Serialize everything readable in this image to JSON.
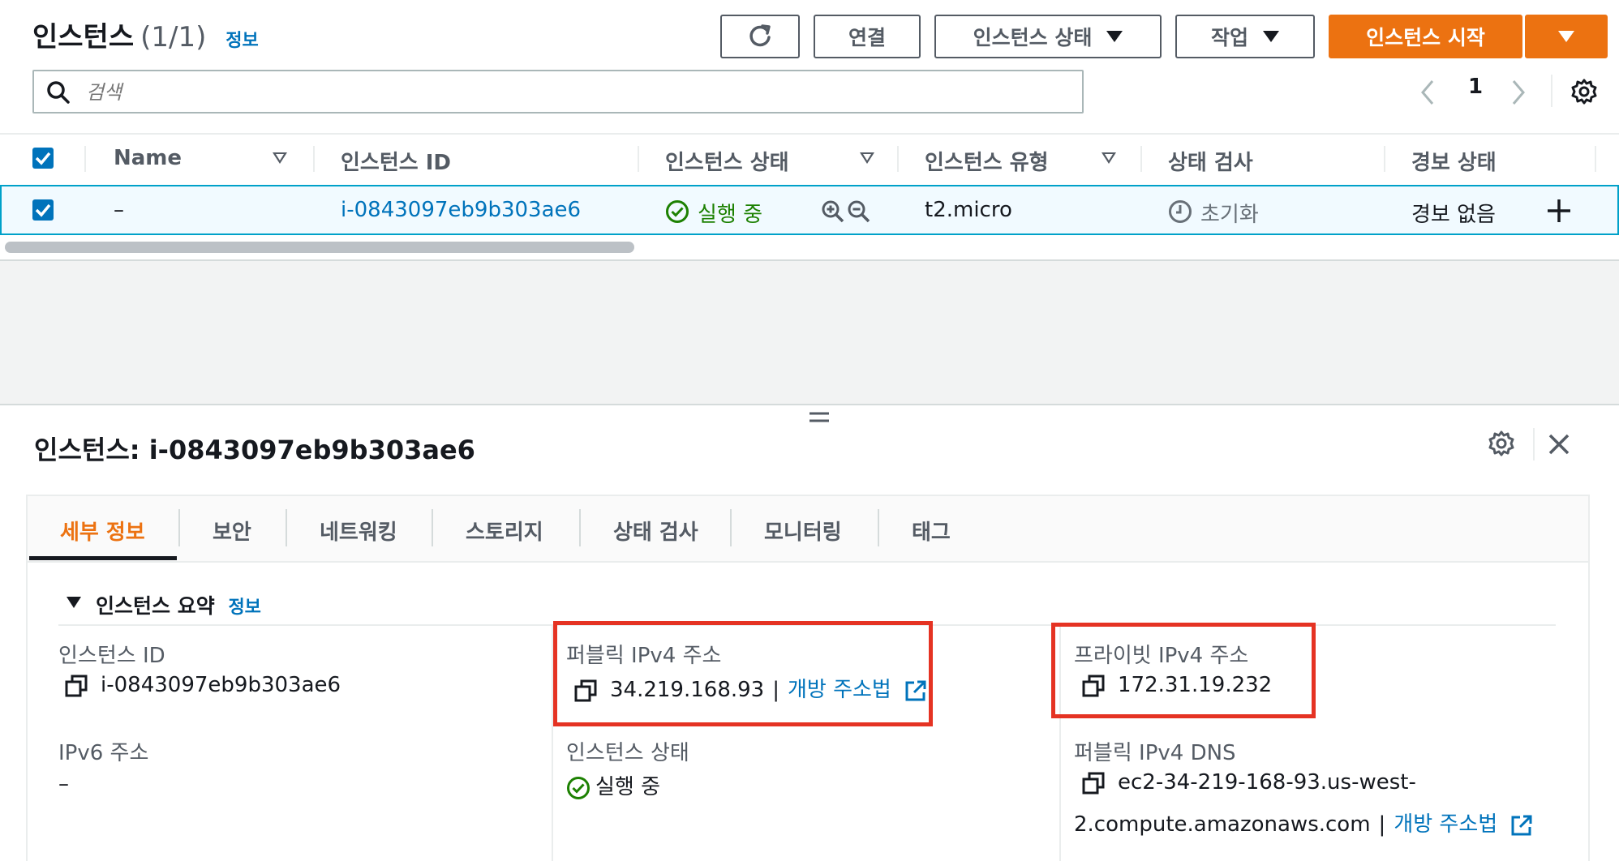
{
  "header": {
    "title": "인스턴스",
    "count": "(1/1)",
    "info_label": "정보",
    "buttons": {
      "connect": "연결",
      "instance_state": "인스턴스 상태",
      "actions": "작업",
      "launch": "인스턴스 시작"
    }
  },
  "search": {
    "placeholder": "검색"
  },
  "pagination": {
    "current_page": "1"
  },
  "table": {
    "columns": [
      "Name",
      "인스턴스 ID",
      "인스턴스 상태",
      "인스턴스 유형",
      "상태 검사",
      "경보 상태"
    ],
    "row": {
      "name": "–",
      "instance_id": "i-0843097eb9b303ae6",
      "state": "실행 중",
      "type": "t2.micro",
      "status_check": "초기화",
      "alarm_status": "경보 없음"
    }
  },
  "details": {
    "title": "인스턴스: i-0843097eb9b303ae6",
    "tabs": [
      "세부 정보",
      "보안",
      "네트워킹",
      "스토리지",
      "상태 검사",
      "모니터링",
      "태그"
    ],
    "section_title": "인스턴스 요약",
    "section_info": "정보",
    "fields": {
      "instance_id_label": "인스턴스 ID",
      "instance_id_value": "i-0843097eb9b303ae6",
      "ipv6_label": "IPv6 주소",
      "ipv6_value": "–",
      "public_ipv4_label": "퍼블릭 IPv4 주소",
      "public_ipv4_value": "34.219.168.93",
      "open_address_label": "개방 주소법",
      "instance_state_label": "인스턴스 상태",
      "instance_state_value": "실행 중",
      "private_ipv4_label": "프라이빗 IPv4 주소",
      "private_ipv4_value": "172.31.19.232",
      "public_dns_label": "퍼블릭 IPv4 DNS",
      "public_dns_line1": "ec2-34-219-168-93.us-west-",
      "public_dns_line2": "2.compute.amazonaws.com",
      "open_address_label_2": "개방 주소법"
    }
  },
  "colors": {
    "accent_orange": "#ec7211",
    "link_blue": "#0073bb",
    "success_green": "#1d8102",
    "highlight_red": "#e53323"
  }
}
